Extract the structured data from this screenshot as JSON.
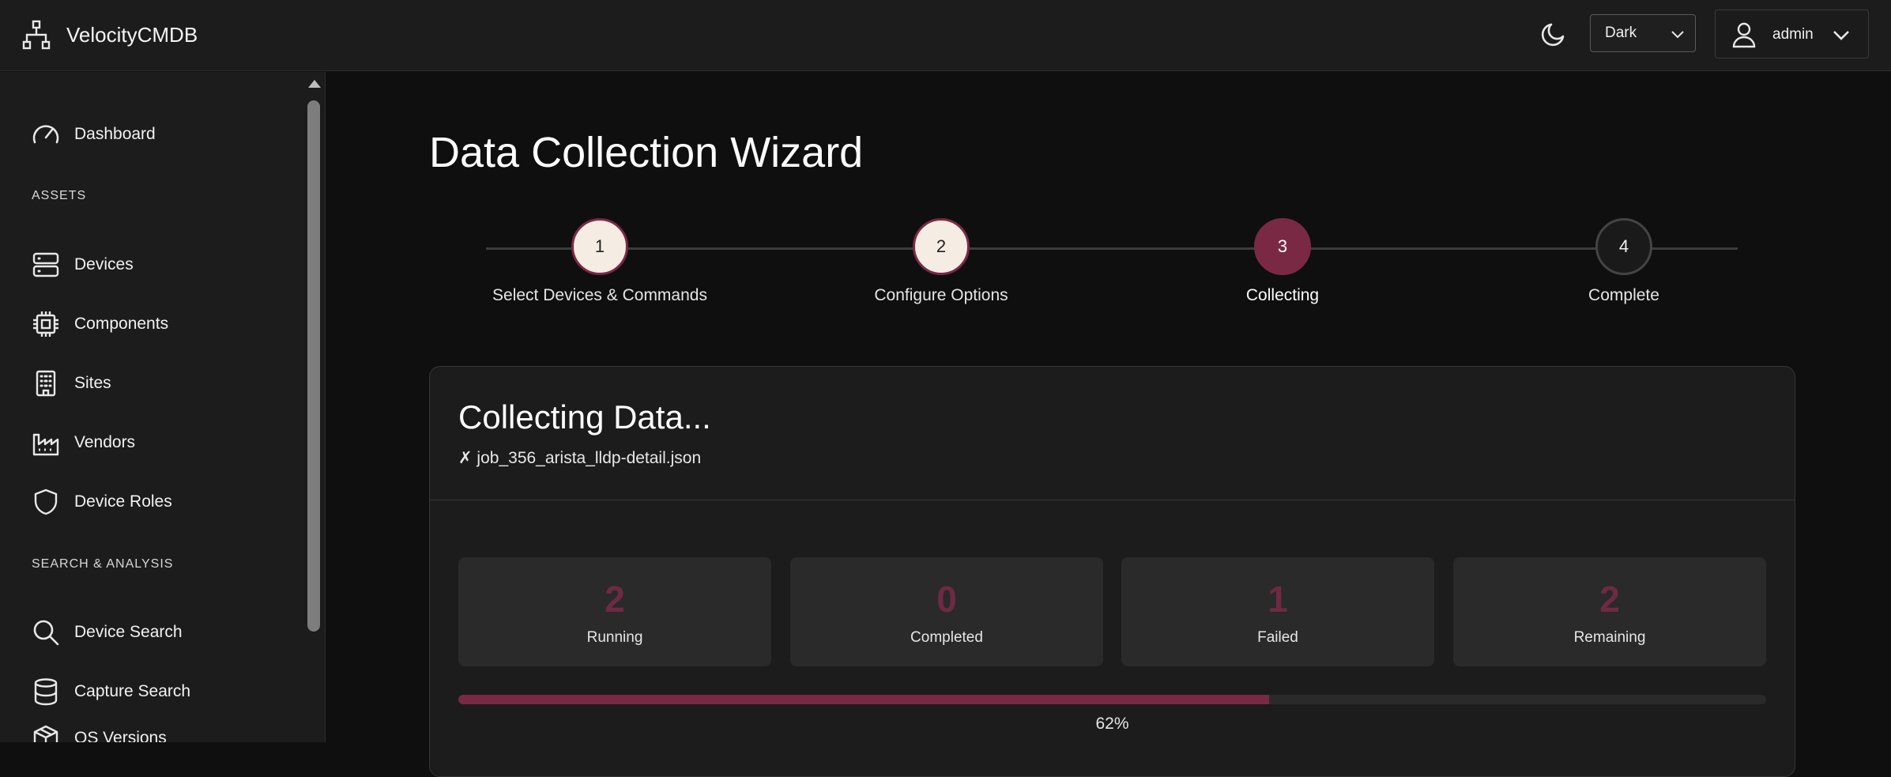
{
  "app": {
    "title": "VelocityCMDB"
  },
  "header": {
    "theme_select": {
      "value": "Dark",
      "options": [
        "Dark",
        "Light"
      ]
    },
    "user": {
      "name": "admin"
    }
  },
  "sidebar": {
    "items": [
      {
        "label": "Dashboard",
        "icon": "gauge-icon"
      },
      {
        "section": "ASSETS"
      },
      {
        "label": "Devices",
        "icon": "server-icon"
      },
      {
        "label": "Components",
        "icon": "cpu-icon"
      },
      {
        "label": "Sites",
        "icon": "building-icon"
      },
      {
        "label": "Vendors",
        "icon": "factory-icon"
      },
      {
        "label": "Device Roles",
        "icon": "shield-icon"
      },
      {
        "section": "SEARCH & ANALYSIS"
      },
      {
        "label": "Device Search",
        "icon": "search-icon"
      },
      {
        "label": "Capture Search",
        "icon": "database-icon"
      },
      {
        "label": "OS Versions",
        "icon": "package-icon"
      }
    ]
  },
  "main": {
    "title": "Data Collection Wizard",
    "steps": [
      {
        "number": "1",
        "label": "Select Devices & Commands",
        "state": "done"
      },
      {
        "number": "2",
        "label": "Configure Options",
        "state": "done"
      },
      {
        "number": "3",
        "label": "Collecting",
        "state": "active"
      },
      {
        "number": "4",
        "label": "Complete",
        "state": "todo"
      }
    ],
    "card": {
      "title": "Collecting Data...",
      "status_line": "✗ job_356_arista_lldp-detail.json",
      "stats": [
        {
          "value": "2",
          "label": "Running"
        },
        {
          "value": "0",
          "label": "Completed"
        },
        {
          "value": "1",
          "label": "Failed"
        },
        {
          "value": "2",
          "label": "Remaining"
        }
      ],
      "progress": {
        "percent": 62,
        "text": "62%"
      }
    }
  },
  "colors": {
    "accent": "#7a2945",
    "stat_number": "#6e2a43",
    "background": "#0f0f0f",
    "panel": "#1c1c1c"
  }
}
